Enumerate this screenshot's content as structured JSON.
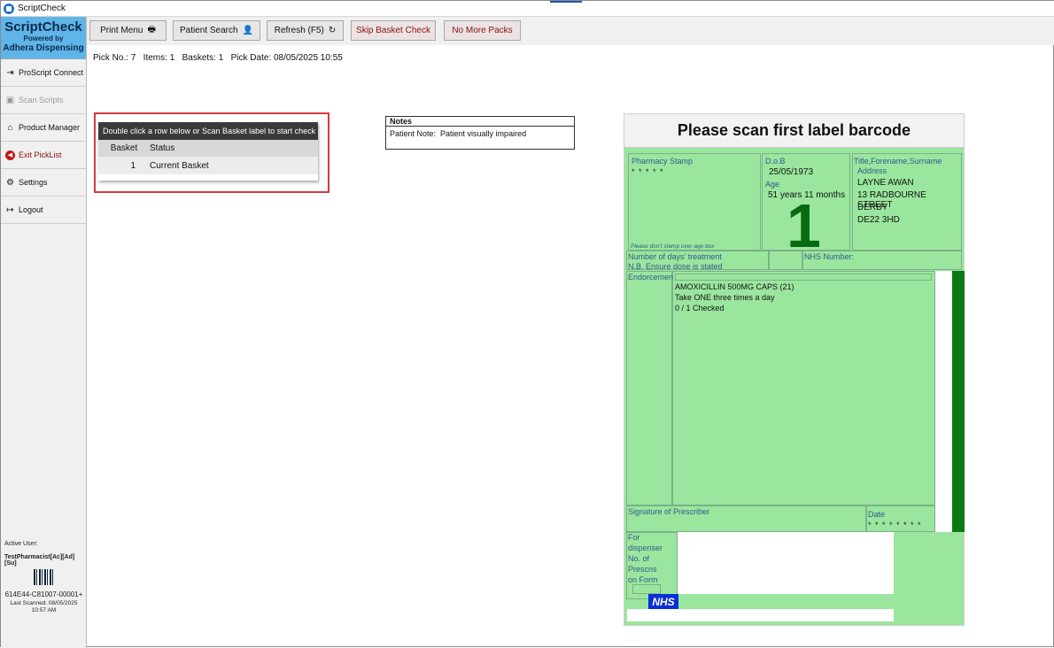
{
  "window": {
    "title": "ScriptCheck"
  },
  "brand": {
    "name": "ScriptCheck",
    "powered_by": "Powered by",
    "company": "Adhera Dispensing"
  },
  "sidebar": {
    "items": [
      {
        "label": "ProScript Connect",
        "icon": "login-icon"
      },
      {
        "label": "Scan Scripts",
        "icon": "scan-icon"
      },
      {
        "label": "Product Manager",
        "icon": "store-icon"
      },
      {
        "label": "Exit PickList",
        "icon": "exit-icon"
      },
      {
        "label": "Settings",
        "icon": "gear-icon"
      },
      {
        "label": "Logout",
        "icon": "logout-icon"
      }
    ],
    "active_user_label": "Active User:",
    "active_user": "TestPharmacist[Ac][Ad][Su]",
    "scan_code": "614E44-C81007-00001+",
    "last_scanned_label": "Last Scanned: 08/05/2025",
    "last_scanned_time": "10:57 AM"
  },
  "toolbar": {
    "print_menu": "Print Menu",
    "patient_search": "Patient Search",
    "refresh": "Refresh (F5)",
    "skip_basket": "Skip Basket Check",
    "no_more_packs": "No More Packs"
  },
  "pick_info": "Pick No.: 7   Items: 1   Baskets: 1   Pick Date: 08/05/2025 10:55",
  "basket_table": {
    "instruction": "Double click a row below or Scan Basket label to start check",
    "columns": [
      "Basket",
      "Status"
    ],
    "rows": [
      {
        "basket": "1",
        "status": "Current Basket"
      }
    ]
  },
  "notes": {
    "title": "Notes",
    "text": "Patient Note:  Patient visually impaired"
  },
  "form": {
    "header": "Please scan first label barcode",
    "pharmacy_stamp_label": "Pharmacy Stamp",
    "stamp_stars": "* * * * *",
    "stamp_note": "Please don't stamp over age box",
    "dob_label": "D.o.B",
    "dob": "25/05/1973",
    "age_label": "Age",
    "age": "51 years 11 months",
    "item_count": "1",
    "title_label": "Title,Forename,Surname",
    "address_label": "Address",
    "address_lines": [
      "LAYNE AWAN",
      "13 RADBOURNE STREET",
      "DERBY",
      "DE22 3HD"
    ],
    "days_treatment_label": "Number of days' treatment",
    "dose_note": "N.B. Ensure dose is stated",
    "nhs_number_label": "NHS Number:",
    "endorsement_label": "Endorcemen",
    "drug_lines": [
      "AMOXICILLIN 500MG CAPS (21)",
      "Take ONE three times a day",
      "0 / 1 Checked"
    ],
    "signature_label": "Signature of Prescriber",
    "date_label": "Date",
    "date_stars": "* * * * * * * *",
    "dispenser_lines": [
      "For",
      "dispenser",
      "No. of",
      "Prescns",
      "on Form"
    ],
    "nhs_logo": "NHS"
  },
  "colors": {
    "form_green": "#9ae69e",
    "brand_blue": "#5fb4e8",
    "highlight_red": "#d9393e",
    "bar_green": "#0b7a14",
    "nhs_blue": "#0a2fd8"
  }
}
